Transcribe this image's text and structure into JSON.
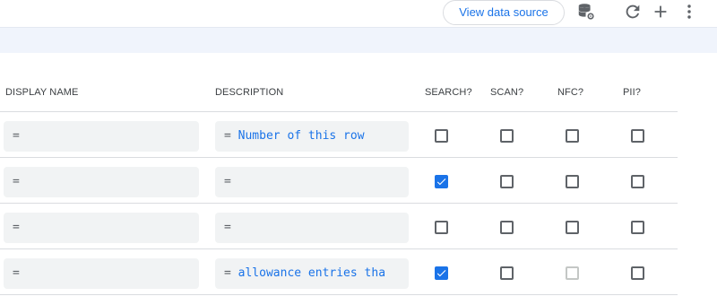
{
  "toolbar": {
    "view_source_label": "View data source",
    "icons": [
      "database-settings-icon",
      "refresh-icon",
      "plus-icon",
      "more-vert-icon"
    ]
  },
  "columns": {
    "display_name": "DISPLAY NAME",
    "description": "DESCRIPTION",
    "search": "SEARCH?",
    "scan": "SCAN?",
    "nfc": "NFC?",
    "pii": "PII?"
  },
  "rows": [
    {
      "display_name": "=",
      "description_eq": "=",
      "description_text": "Number of this row",
      "search": false,
      "scan": false,
      "nfc": false,
      "nfc_disabled": false,
      "pii": false
    },
    {
      "display_name": "=",
      "description_eq": "=",
      "description_text": "",
      "search": true,
      "scan": false,
      "nfc": false,
      "nfc_disabled": false,
      "pii": false
    },
    {
      "display_name": "=",
      "description_eq": "=",
      "description_text": "",
      "search": false,
      "scan": false,
      "nfc": false,
      "nfc_disabled": false,
      "pii": false
    },
    {
      "display_name": "=",
      "description_eq": "=",
      "description_text": "allowance entries tha",
      "search": true,
      "scan": false,
      "nfc": false,
      "nfc_disabled": true,
      "pii": false
    }
  ],
  "colors": {
    "accent": "#1a73e8",
    "band": "#f0f4fc",
    "field_bg": "#f1f3f4"
  }
}
